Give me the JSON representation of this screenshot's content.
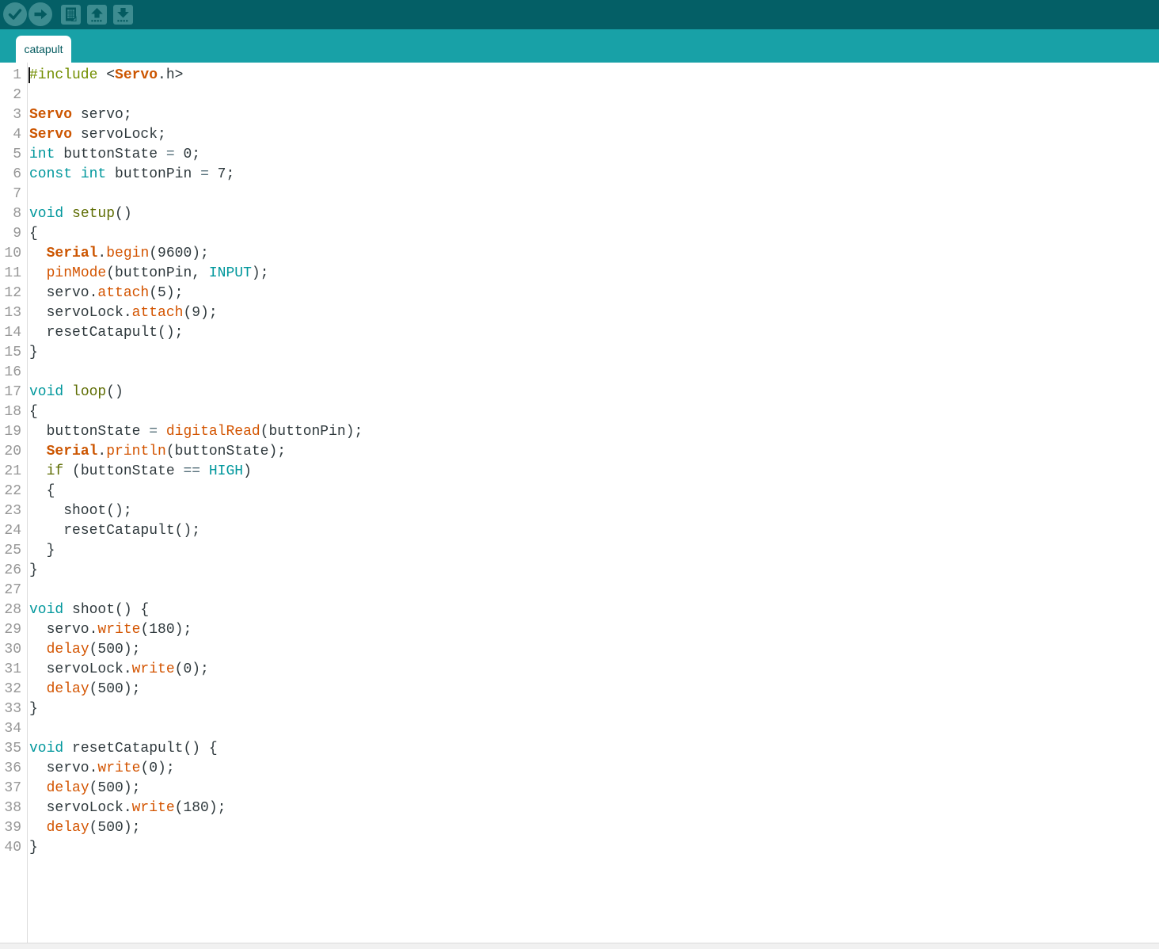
{
  "toolbar": {
    "bg": "#045F66",
    "button_bg": "#3D8C90",
    "glyph_color": "#045B60",
    "buttons": [
      {
        "id": "verify",
        "icon": "check-icon"
      },
      {
        "id": "upload",
        "icon": "arrow-right-icon"
      },
      {
        "id": "new-sketch",
        "icon": "document-icon"
      },
      {
        "id": "open",
        "icon": "arrow-up-icon"
      },
      {
        "id": "save",
        "icon": "arrow-down-icon"
      }
    ]
  },
  "tabbar": {
    "bg": "#18A1A7",
    "tabs": [
      {
        "label": "catapult",
        "active": true
      }
    ]
  },
  "editor": {
    "colors": {
      "default": "#2F393D",
      "operator": "#56707A",
      "keyword": "#00979C",
      "structure": "#5E6D03",
      "preprocessor": "#728E00",
      "function": "#D35400",
      "class": "#CC5500",
      "line_number": "#969696",
      "gutter_line": "#DCDCDC"
    },
    "lines": [
      {
        "n": "1",
        "seg": [
          [
            "p",
            "#include"
          ],
          [
            "d",
            " <"
          ],
          [
            "c",
            "Servo"
          ],
          [
            "d",
            ".h>"
          ]
        ]
      },
      {
        "n": "2",
        "seg": []
      },
      {
        "n": "3",
        "seg": [
          [
            "c",
            "Servo"
          ],
          [
            "d",
            " servo;"
          ]
        ]
      },
      {
        "n": "4",
        "seg": [
          [
            "c",
            "Servo"
          ],
          [
            "d",
            " servoLock;"
          ]
        ]
      },
      {
        "n": "5",
        "seg": [
          [
            "k",
            "int"
          ],
          [
            "d",
            " buttonState "
          ],
          [
            "o",
            "="
          ],
          [
            "d",
            " 0;"
          ]
        ]
      },
      {
        "n": "6",
        "seg": [
          [
            "k",
            "const"
          ],
          [
            "d",
            " "
          ],
          [
            "k",
            "int"
          ],
          [
            "d",
            " buttonPin "
          ],
          [
            "o",
            "="
          ],
          [
            "d",
            " 7;"
          ]
        ]
      },
      {
        "n": "7",
        "seg": []
      },
      {
        "n": "8",
        "seg": [
          [
            "k",
            "void"
          ],
          [
            "d",
            " "
          ],
          [
            "s",
            "setup"
          ],
          [
            "d",
            "()"
          ]
        ]
      },
      {
        "n": "9",
        "seg": [
          [
            "d",
            "{"
          ]
        ]
      },
      {
        "n": "10",
        "seg": [
          [
            "d",
            "  "
          ],
          [
            "c",
            "Serial"
          ],
          [
            "d",
            "."
          ],
          [
            "f",
            "begin"
          ],
          [
            "d",
            "(9600);"
          ]
        ]
      },
      {
        "n": "11",
        "seg": [
          [
            "d",
            "  "
          ],
          [
            "f",
            "pinMode"
          ],
          [
            "d",
            "(buttonPin, "
          ],
          [
            "k",
            "INPUT"
          ],
          [
            "d",
            ");"
          ]
        ]
      },
      {
        "n": "12",
        "seg": [
          [
            "d",
            "  servo."
          ],
          [
            "f",
            "attach"
          ],
          [
            "d",
            "(5);"
          ]
        ]
      },
      {
        "n": "13",
        "seg": [
          [
            "d",
            "  servoLock."
          ],
          [
            "f",
            "attach"
          ],
          [
            "d",
            "(9);"
          ]
        ]
      },
      {
        "n": "14",
        "seg": [
          [
            "d",
            "  resetCatapult();"
          ]
        ]
      },
      {
        "n": "15",
        "seg": [
          [
            "d",
            "}"
          ]
        ]
      },
      {
        "n": "16",
        "seg": []
      },
      {
        "n": "17",
        "seg": [
          [
            "k",
            "void"
          ],
          [
            "d",
            " "
          ],
          [
            "s",
            "loop"
          ],
          [
            "d",
            "()"
          ]
        ]
      },
      {
        "n": "18",
        "seg": [
          [
            "d",
            "{"
          ]
        ]
      },
      {
        "n": "19",
        "seg": [
          [
            "d",
            "  buttonState "
          ],
          [
            "o",
            "="
          ],
          [
            "d",
            " "
          ],
          [
            "f",
            "digitalRead"
          ],
          [
            "d",
            "(buttonPin);"
          ]
        ]
      },
      {
        "n": "20",
        "seg": [
          [
            "d",
            "  "
          ],
          [
            "c",
            "Serial"
          ],
          [
            "d",
            "."
          ],
          [
            "f",
            "println"
          ],
          [
            "d",
            "(buttonState);"
          ]
        ]
      },
      {
        "n": "21",
        "seg": [
          [
            "d",
            "  "
          ],
          [
            "s",
            "if"
          ],
          [
            "d",
            " (buttonState "
          ],
          [
            "o",
            "=="
          ],
          [
            "d",
            " "
          ],
          [
            "k",
            "HIGH"
          ],
          [
            "d",
            ")"
          ]
        ]
      },
      {
        "n": "22",
        "seg": [
          [
            "d",
            "  {"
          ]
        ]
      },
      {
        "n": "23",
        "seg": [
          [
            "d",
            "    shoot();"
          ]
        ]
      },
      {
        "n": "24",
        "seg": [
          [
            "d",
            "    resetCatapult();"
          ]
        ]
      },
      {
        "n": "25",
        "seg": [
          [
            "d",
            "  }"
          ]
        ]
      },
      {
        "n": "26",
        "seg": [
          [
            "d",
            "}"
          ]
        ]
      },
      {
        "n": "27",
        "seg": []
      },
      {
        "n": "28",
        "seg": [
          [
            "k",
            "void"
          ],
          [
            "d",
            " shoot() {"
          ]
        ]
      },
      {
        "n": "29",
        "seg": [
          [
            "d",
            "  servo."
          ],
          [
            "f",
            "write"
          ],
          [
            "d",
            "(180);"
          ]
        ]
      },
      {
        "n": "30",
        "seg": [
          [
            "d",
            "  "
          ],
          [
            "f",
            "delay"
          ],
          [
            "d",
            "(500);"
          ]
        ]
      },
      {
        "n": "31",
        "seg": [
          [
            "d",
            "  servoLock."
          ],
          [
            "f",
            "write"
          ],
          [
            "d",
            "(0);"
          ]
        ]
      },
      {
        "n": "32",
        "seg": [
          [
            "d",
            "  "
          ],
          [
            "f",
            "delay"
          ],
          [
            "d",
            "(500);"
          ]
        ]
      },
      {
        "n": "33",
        "seg": [
          [
            "d",
            "}"
          ]
        ]
      },
      {
        "n": "34",
        "seg": []
      },
      {
        "n": "35",
        "seg": [
          [
            "k",
            "void"
          ],
          [
            "d",
            " resetCatapult() {"
          ]
        ]
      },
      {
        "n": "36",
        "seg": [
          [
            "d",
            "  servo."
          ],
          [
            "f",
            "write"
          ],
          [
            "d",
            "(0);"
          ]
        ]
      },
      {
        "n": "37",
        "seg": [
          [
            "d",
            "  "
          ],
          [
            "f",
            "delay"
          ],
          [
            "d",
            "(500);"
          ]
        ]
      },
      {
        "n": "38",
        "seg": [
          [
            "d",
            "  servoLock."
          ],
          [
            "f",
            "write"
          ],
          [
            "d",
            "(180);"
          ]
        ]
      },
      {
        "n": "39",
        "seg": [
          [
            "d",
            "  "
          ],
          [
            "f",
            "delay"
          ],
          [
            "d",
            "(500);"
          ]
        ]
      },
      {
        "n": "40",
        "seg": [
          [
            "d",
            "}"
          ]
        ]
      }
    ]
  }
}
